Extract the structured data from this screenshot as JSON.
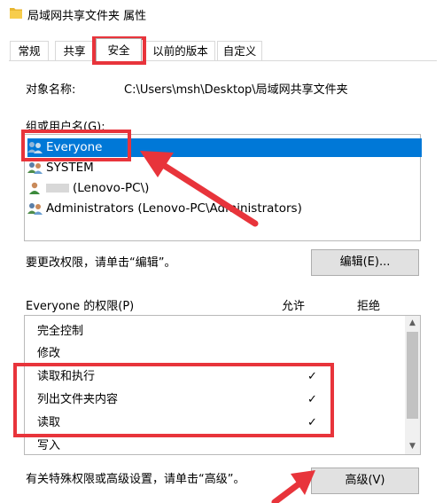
{
  "window": {
    "title": "局域网共享文件夹 属性"
  },
  "tabs": [
    "常规",
    "共享",
    "安全",
    "以前的版本",
    "自定义"
  ],
  "object": {
    "label": "对象名称:",
    "path": "C:\\Users\\msh\\Desktop\\局域网共享文件夹"
  },
  "groups": {
    "label": "组或用户名(G):",
    "users": [
      {
        "name": "Everyone",
        "icon": "group-users-icon"
      },
      {
        "name": "SYSTEM",
        "icon": "group-users-icon"
      },
      {
        "name": "(Lenovo-PC\\)",
        "icon": "single-user-icon"
      },
      {
        "name": "Administrators (Lenovo-PC\\Administrators)",
        "icon": "group-users-icon"
      }
    ]
  },
  "edit": {
    "hint": "要更改权限，请单击“编辑”。",
    "button": "编辑(E)..."
  },
  "permissions": {
    "title": "Everyone 的权限(P)",
    "allow": "允许",
    "deny": "拒绝",
    "rows": [
      {
        "name": "完全控制",
        "allow": ""
      },
      {
        "name": "修改",
        "allow": ""
      },
      {
        "name": "读取和执行",
        "allow": "✓"
      },
      {
        "name": "列出文件夹内容",
        "allow": "✓"
      },
      {
        "name": "读取",
        "allow": "✓"
      },
      {
        "name": "写入",
        "allow": ""
      }
    ]
  },
  "advanced": {
    "hint": "有关特殊权限或高级设置，请单击“高级”。",
    "button": "高级(V)"
  },
  "annotation_color": "#e8343b",
  "selection_color": "#0078d7"
}
